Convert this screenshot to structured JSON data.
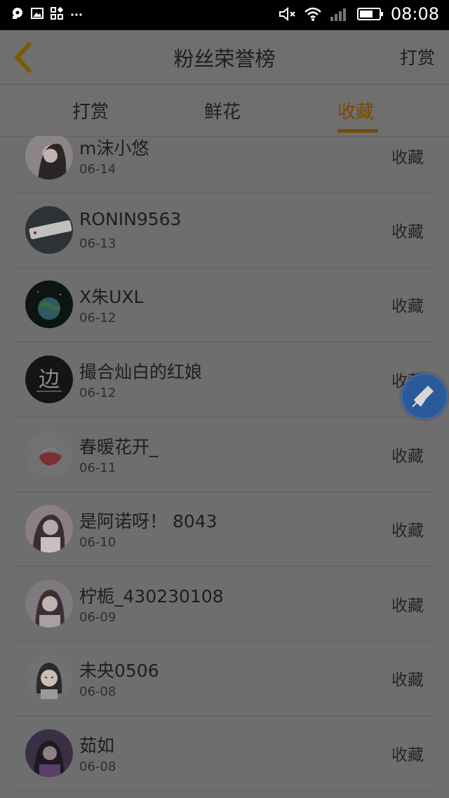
{
  "status_bar": {
    "time": "08:08",
    "icons": [
      "notification-icon",
      "image-icon",
      "apps-icon",
      "more-icon",
      "mute-icon",
      "wifi-icon",
      "signal-icon",
      "battery-icon"
    ]
  },
  "header": {
    "title": "粉丝荣誉榜",
    "action_label": "打赏"
  },
  "tabs": [
    {
      "label": "打赏",
      "active": false
    },
    {
      "label": "鲜花",
      "active": false
    },
    {
      "label": "收藏",
      "active": true
    }
  ],
  "accent_color": "#7a4a00",
  "fans": [
    {
      "name": "m沫小悠",
      "date": "06-14",
      "action": "收藏"
    },
    {
      "name": "RONIN9563",
      "date": "06-13",
      "action": "收藏"
    },
    {
      "name": "X朱UXL",
      "date": "06-12",
      "action": "收藏"
    },
    {
      "name": "撮合灿白的红娘",
      "date": "06-12",
      "action": "收藏"
    },
    {
      "name": "春暖花开_",
      "date": "06-11",
      "action": "收藏"
    },
    {
      "name": "是阿诺呀！ 8043",
      "date": "06-10",
      "action": "收藏"
    },
    {
      "name": "柠栀_430230108",
      "date": "06-09",
      "action": "收藏"
    },
    {
      "name": "未央0506",
      "date": "06-08",
      "action": "收藏"
    },
    {
      "name": "茹如",
      "date": "06-08",
      "action": "收藏"
    }
  ],
  "avatar_logo_text": "边"
}
